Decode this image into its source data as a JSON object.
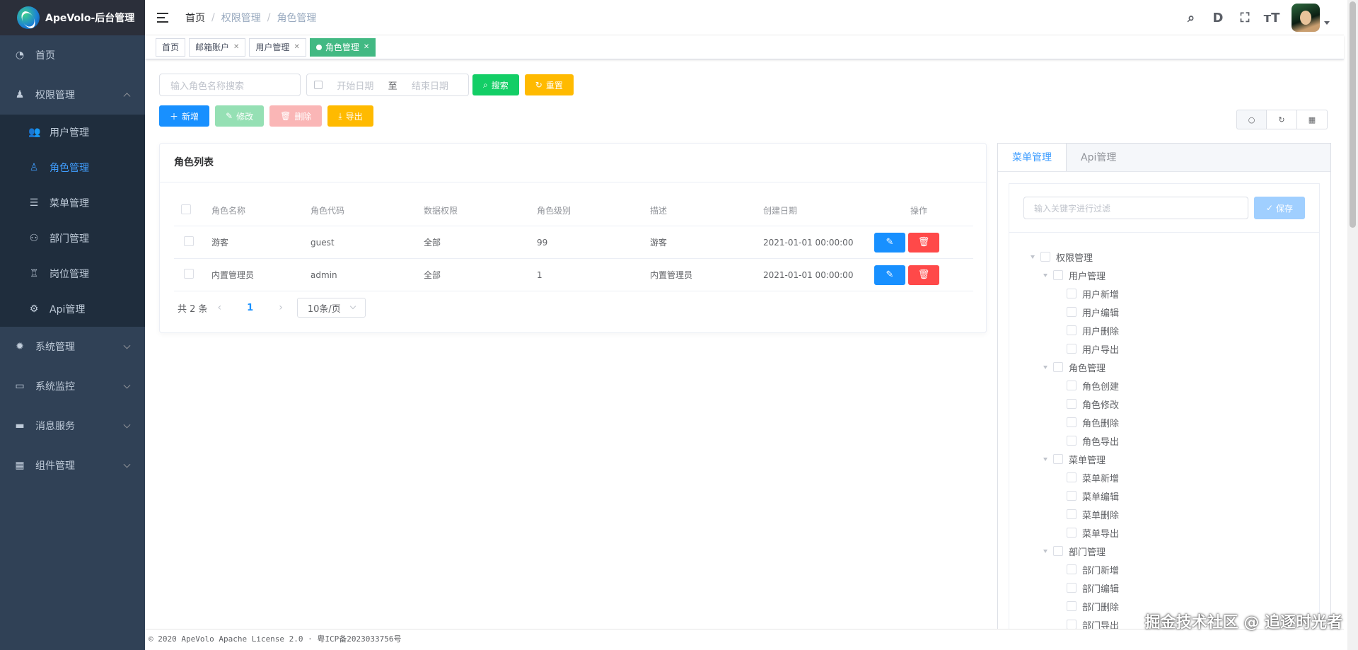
{
  "app": {
    "title": "ApeVolo-后台管理"
  },
  "sidebar": {
    "items": [
      {
        "label": "首页",
        "icon": "dashboard-icon"
      },
      {
        "label": "权限管理",
        "icon": "permission-icon",
        "expanded": true,
        "children": [
          {
            "label": "用户管理",
            "icon": "user-icon"
          },
          {
            "label": "角色管理",
            "icon": "role-icon",
            "active": true
          },
          {
            "label": "菜单管理",
            "icon": "menu-icon"
          },
          {
            "label": "部门管理",
            "icon": "dept-icon"
          },
          {
            "label": "岗位管理",
            "icon": "job-icon"
          },
          {
            "label": "Api管理",
            "icon": "api-icon"
          }
        ]
      },
      {
        "label": "系统管理",
        "icon": "gear-icon"
      },
      {
        "label": "系统监控",
        "icon": "monitor-icon"
      },
      {
        "label": "消息服务",
        "icon": "message-icon"
      },
      {
        "label": "组件管理",
        "icon": "component-icon"
      }
    ]
  },
  "breadcrumb": [
    "首页",
    "权限管理",
    "角色管理"
  ],
  "tags": [
    {
      "label": "首页"
    },
    {
      "label": "邮箱账户"
    },
    {
      "label": "用户管理"
    },
    {
      "label": "角色管理",
      "active": true
    }
  ],
  "search": {
    "name_placeholder": "输入角色名称搜索",
    "start_placeholder": "开始日期",
    "range_sep": "至",
    "end_placeholder": "结束日期",
    "search_label": "搜索",
    "reset_label": "重置"
  },
  "crud": {
    "add": "新增",
    "edit": "修改",
    "delete": "删除",
    "export": "导出"
  },
  "roles": {
    "title": "角色列表",
    "columns": [
      "角色名称",
      "角色代码",
      "数据权限",
      "角色级别",
      "描述",
      "创建日期",
      "操作"
    ],
    "rows": [
      {
        "name": "游客",
        "code": "guest",
        "scope": "全部",
        "level": "99",
        "desc": "游客",
        "created": "2021-01-01 00:00:00"
      },
      {
        "name": "内置管理员",
        "code": "admin",
        "scope": "全部",
        "level": "1",
        "desc": "内置管理员",
        "created": "2021-01-01 00:00:00"
      }
    ],
    "pagination": {
      "total": "共 2 条",
      "page": "1",
      "size": "10条/页"
    }
  },
  "menu_panel": {
    "tabs": [
      "菜单管理",
      "Api管理"
    ],
    "filter_placeholder": "输入关键字进行过滤",
    "save_label": "保存",
    "tree": [
      {
        "label": "权限管理",
        "level": 0,
        "arrow": true
      },
      {
        "label": "用户管理",
        "level": 1,
        "arrow": true
      },
      {
        "label": "用户新增",
        "level": 2
      },
      {
        "label": "用户编辑",
        "level": 2
      },
      {
        "label": "用户删除",
        "level": 2
      },
      {
        "label": "用户导出",
        "level": 2
      },
      {
        "label": "角色管理",
        "level": 1,
        "arrow": true
      },
      {
        "label": "角色创建",
        "level": 2
      },
      {
        "label": "角色修改",
        "level": 2
      },
      {
        "label": "角色删除",
        "level": 2
      },
      {
        "label": "角色导出",
        "level": 2
      },
      {
        "label": "菜单管理",
        "level": 1,
        "arrow": true
      },
      {
        "label": "菜单新增",
        "level": 2
      },
      {
        "label": "菜单编辑",
        "level": 2
      },
      {
        "label": "菜单删除",
        "level": 2
      },
      {
        "label": "菜单导出",
        "level": 2
      },
      {
        "label": "部门管理",
        "level": 1,
        "arrow": true
      },
      {
        "label": "部门新增",
        "level": 2
      },
      {
        "label": "部门编辑",
        "level": 2
      },
      {
        "label": "部门删除",
        "level": 2
      },
      {
        "label": "部门导出",
        "level": 2
      }
    ]
  },
  "footer": {
    "text": "© 2020 ApeVolo Apache License 2.0 · 粤ICP备2023033756号"
  },
  "watermark": "掘金技术社区 @ 追逐时光者",
  "colors": {
    "sidebar": "#304156",
    "submenu": "#1f2d3d",
    "primary": "#1890ff",
    "success": "#13ce66",
    "warning": "#ffba00",
    "danger": "#ff4949",
    "tag_active": "#42b983"
  }
}
